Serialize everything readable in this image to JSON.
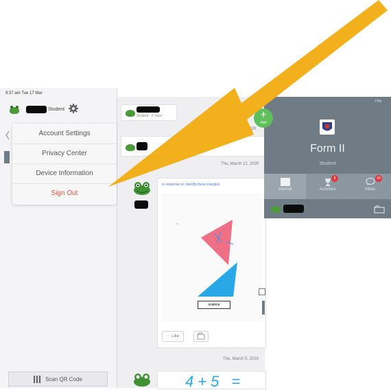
{
  "status_bar": {
    "time_date": "9:37 am  Tue 17 Mar",
    "battery": "77%"
  },
  "sidebar": {
    "user_role": "Student",
    "menu": [
      "Account Settings",
      "Privacy Center",
      "Device Information",
      "Sign Out"
    ],
    "scan_label": "Scan QR Code"
  },
  "feed": {
    "header_sub": "Student - 1 class",
    "dates": [
      "Tue, March 17, 2020",
      "Thu, March 12, 2020",
      "Thu, March 5, 2020"
    ],
    "post_prompt": "In response to: Identify these triangles",
    "triangle_label": "scalene",
    "like_label": "Like",
    "handwriting": "4+5 ="
  },
  "panel": {
    "add_label": "Add",
    "class_name": "Form II",
    "role": "Student",
    "tabs": [
      {
        "label": "Journal",
        "badge": ""
      },
      {
        "label": "Activities",
        "badge": "8"
      },
      {
        "label": "Inbox",
        "badge": "43"
      }
    ]
  },
  "colors": {
    "arrow": "#f3b01d",
    "signout": "#e2533f",
    "panel": "#6f7c86",
    "add": "#5fbf5a"
  }
}
